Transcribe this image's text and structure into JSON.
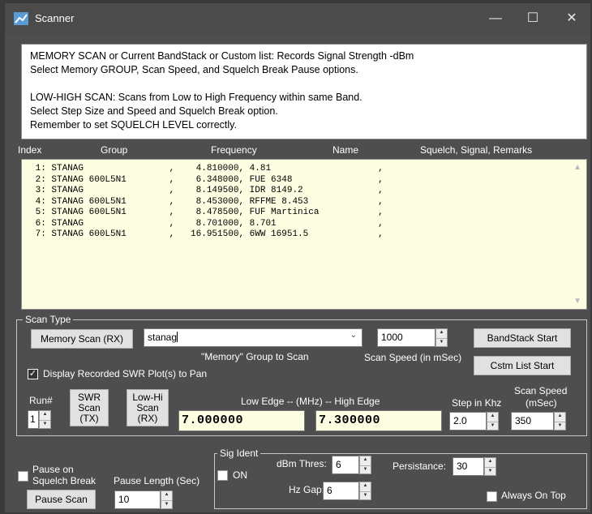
{
  "window": {
    "title": "Scanner",
    "controls": {
      "minimize": "—",
      "maximize": "☐",
      "close": "✕"
    }
  },
  "info_text": [
    "MEMORY SCAN or Current BandStack or Custom list:  Records Signal Strength -dBm",
    "Select Memory GROUP, Scan Speed, and Squelch Break Pause options.",
    "",
    "LOW-HIGH SCAN: Scans from Low to High Frequency within same Band.",
    "Select Step Size and Speed and Squelch Break option.",
    "Remember to set SQUELCH LEVEL correctly."
  ],
  "list": {
    "columns": {
      "index": "Index",
      "group": "Group",
      "frequency": "Frequency",
      "name": "Name",
      "remarks": "Squelch, Signal, Remarks"
    },
    "rows": [
      {
        "index": "1:",
        "group": "STANAG",
        "frequency": "4.810000",
        "name": "4.81"
      },
      {
        "index": "2:",
        "group": "STANAG 600L5N1",
        "frequency": "6.348000",
        "name": "FUE 6348"
      },
      {
        "index": "3:",
        "group": "STANAG",
        "frequency": "8.149500",
        "name": "IDR 8149.2"
      },
      {
        "index": "4:",
        "group": "STANAG 600L5N1",
        "frequency": "8.453000",
        "name": "RFFME 8.453"
      },
      {
        "index": "5:",
        "group": "STANAG 600L5N1",
        "frequency": "8.478500",
        "name": "FUF Martinica"
      },
      {
        "index": "6:",
        "group": "STANAG",
        "frequency": "8.701000",
        "name": "8.701"
      },
      {
        "index": "7:",
        "group": "STANAG 600L5N1",
        "frequency": "16.951500",
        "name": "6WW 16951.5"
      }
    ]
  },
  "scan_type": {
    "legend": "Scan Type",
    "memory_scan_button": "Memory Scan (RX)",
    "group_value": "stanag",
    "group_caption": "\"Memory\" Group to Scan",
    "scan_speed_value": "1000",
    "scan_speed_caption": "Scan Speed (in mSec)",
    "bandstack_button": "BandStack Start",
    "cstm_list_button": "Cstm List Start",
    "display_swr_label": "Display Recorded SWR Plot(s) to Pan",
    "display_swr_checked": true,
    "run_label": "Run#",
    "run_value": "1",
    "swr_scan_button": [
      "SWR",
      "Scan",
      "(TX)"
    ],
    "lowhi_scan_button": [
      "Low-Hi",
      "Scan",
      "(RX)"
    ],
    "edge_caption": "Low Edge --  (MHz)  --  High Edge",
    "low_edge": "7.000000",
    "high_edge": "7.300000",
    "step_caption": "Step in Khz",
    "step_value": "2.0",
    "speed_caption": [
      "Scan Speed",
      "(mSec)"
    ],
    "speed_value": "350"
  },
  "bottom": {
    "pause_on_squelch": [
      "Pause on",
      "Squelch Break"
    ],
    "pause_length_label": "Pause Length (Sec)",
    "pause_length_value": "10",
    "pause_scan_button": "Pause Scan",
    "sig_ident_legend": "Sig Ident",
    "on_label": "ON",
    "dbm_thres_label": "dBm Thres:",
    "dbm_thres_value": "6",
    "hz_gap_label": "Hz Gap:",
    "hz_gap_value": "6",
    "persistance_label": "Persistance:",
    "persistance_value": "30",
    "always_on_top_label": "Always On Top"
  }
}
